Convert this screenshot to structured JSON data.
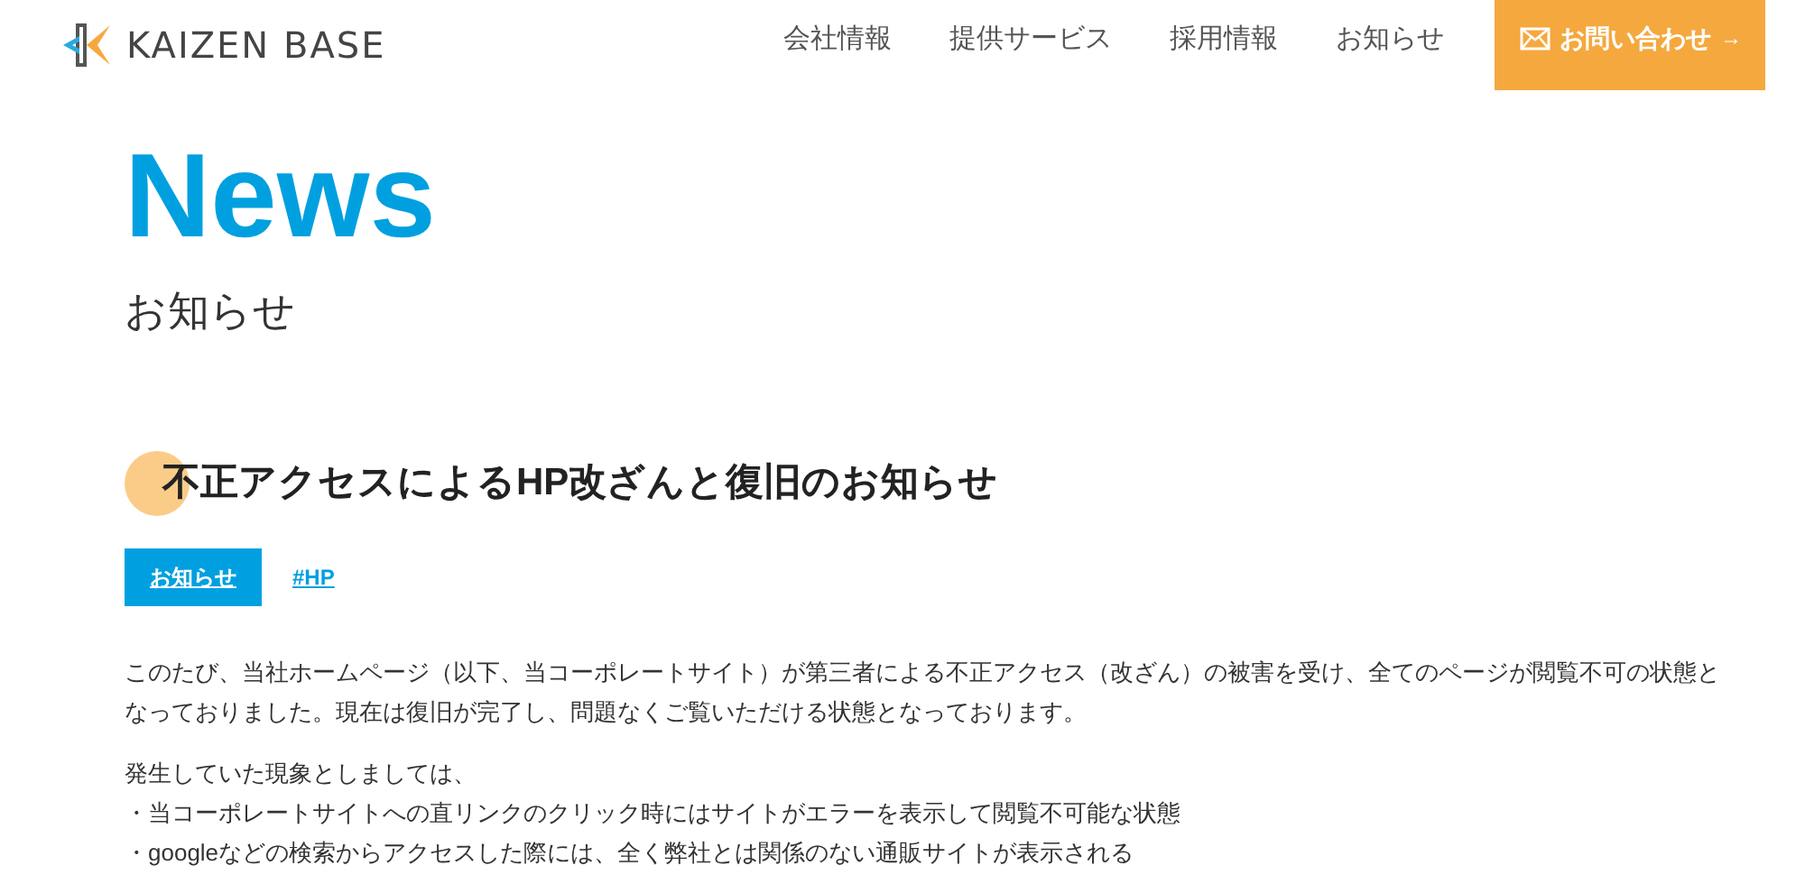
{
  "header": {
    "logo": "KAIZEN BASE",
    "nav": [
      "会社情報",
      "提供サービス",
      "採用情報",
      "お知らせ"
    ],
    "contact_button": "お問い合わせ",
    "contact_arrow": "→"
  },
  "page": {
    "title": "News",
    "subtitle": "お知らせ"
  },
  "article": {
    "title": "不正アクセスによるHP改ざんと復旧のお知らせ",
    "category": "お知らせ",
    "tags": [
      "#HP"
    ],
    "paragraphs": [
      [
        "このたび、当社ホームページ（以下、当コーポレートサイト）が第三者による不正アクセス（改ざん）の被害を受け、全てのページが閲覧不可の状態となっておりました。現在は復旧が完了し、問題なくご覧いただける状態となっております。"
      ],
      [
        "発生していた現象としましては、",
        "・当コーポレートサイトへの直リンクのクリック時にはサイトがエラーを表示して閲覧不可能な状態",
        "・googleなどの検索からアクセスした際には、全く弊社とは関係のない通販サイトが表示される"
      ]
    ]
  }
}
